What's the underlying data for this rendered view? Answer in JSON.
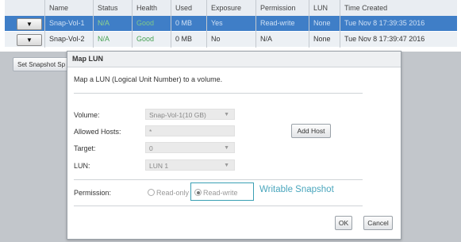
{
  "table": {
    "headers": {
      "name": "Name",
      "status": "Status",
      "health": "Health",
      "used": "Used",
      "exposure": "Exposure",
      "permission": "Permission",
      "lun": "LUN",
      "time_created": "Time Created"
    },
    "rows": [
      {
        "arrow": "▼",
        "name": "Snap-Vol-1",
        "status": "N/A",
        "health": "Good",
        "used": "0 MB",
        "exposure": "Yes",
        "permission": "Read-write",
        "lun": "None",
        "time_created": "Tue Nov 8 17:39:35 2016"
      },
      {
        "arrow": "▼",
        "name": "Snap-Vol-2",
        "status": "N/A",
        "health": "Good",
        "used": "0 MB",
        "exposure": "No",
        "permission": "N/A",
        "lun": "None",
        "time_created": "Tue Nov 8 17:39:47 2016"
      }
    ]
  },
  "toolbar": {
    "set_snapshot_label": "Set Snapshot Sp"
  },
  "dialog": {
    "title": "Map LUN",
    "description": "Map a LUN (Logical Unit Number) to a volume.",
    "volume_label": "Volume:",
    "volume_value": "Snap-Vol-1(10 GB)",
    "allowed_hosts_label": "Allowed Hosts:",
    "allowed_hosts_value": "*",
    "add_host_label": "Add Host",
    "target_label": "Target:",
    "target_value": "0",
    "lun_label": "LUN:",
    "lun_value": "LUN 1",
    "permission_label": "Permission:",
    "permission_read_only": "Read-only",
    "permission_read_write": "Read-write",
    "permission_selected": "Read-write",
    "ok_label": "OK",
    "cancel_label": "Cancel",
    "dropdown_arrow": "▼"
  },
  "annotation": {
    "callout_text": "Writable Snapshot",
    "color": "#3a9fb4"
  }
}
